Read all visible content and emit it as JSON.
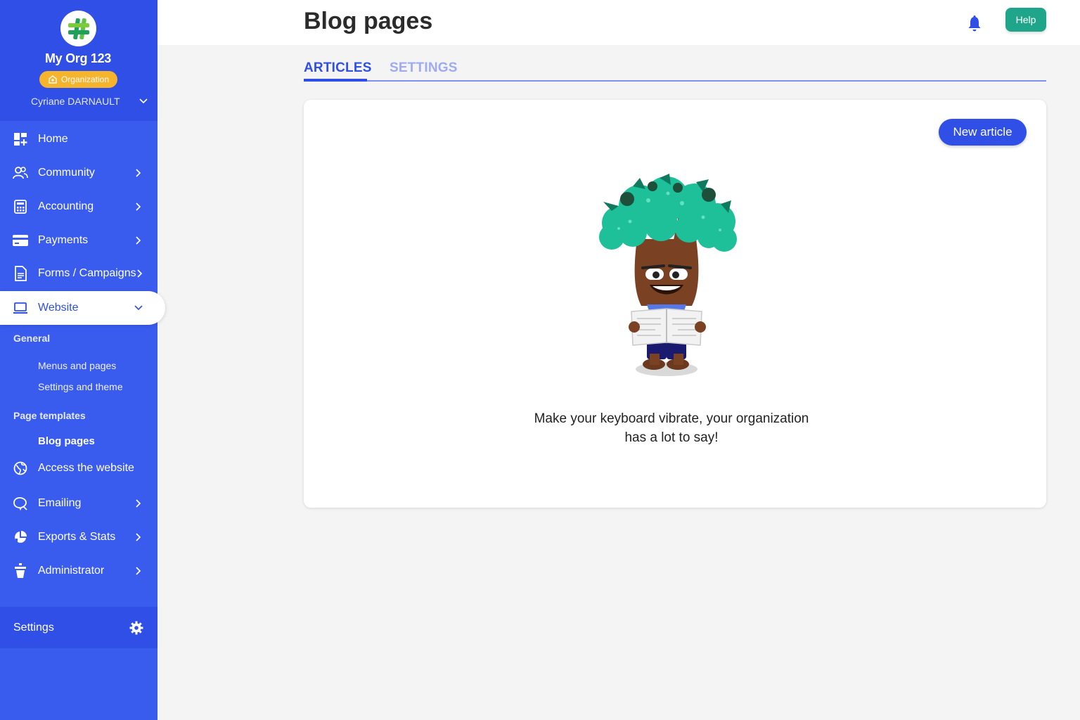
{
  "org": {
    "name": "My Org 123",
    "badge": "Organization",
    "user": "Cyriane DARNAULT"
  },
  "nav": {
    "home": "Home",
    "community": "Community",
    "accounting": "Accounting",
    "payments": "Payments",
    "forms": "Forms / Campaigns",
    "website": "Website",
    "access_website": "Access the website",
    "emailing": "Emailing",
    "exports": "Exports & Stats",
    "administrator": "Administrator",
    "settings": "Settings"
  },
  "website_sub": {
    "general_head": "General",
    "menus": "Menus and pages",
    "settings_theme": "Settings and theme",
    "templates_head": "Page templates",
    "blog": "Blog pages"
  },
  "header": {
    "title": "Blog pages",
    "help": "Help"
  },
  "tabs": {
    "articles": "ARTICLES",
    "settings": "SETTINGS"
  },
  "content": {
    "new_article": "New article",
    "empty_line1": "Make your keyboard vibrate, your organization",
    "empty_line2": "has a lot to say!"
  },
  "colors": {
    "sidebar": "#3a5cee",
    "primary": "#2f4fe6",
    "help": "#1fa68a",
    "badge": "#f6b42c"
  }
}
